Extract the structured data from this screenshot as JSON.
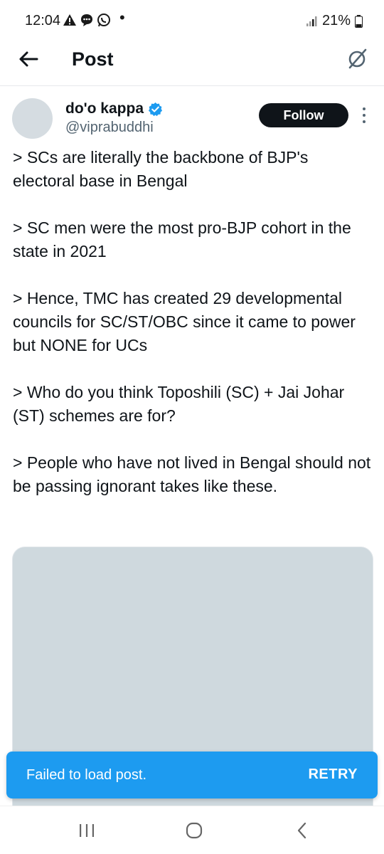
{
  "status_bar": {
    "time": "12:04",
    "battery": "21%",
    "icons": [
      "warning-icon",
      "chat-bubble-icon",
      "whatsapp-icon",
      "signal-icon",
      "battery-icon"
    ]
  },
  "header": {
    "title": "Post",
    "back_icon": "arrow-left-icon",
    "grok_icon": "grok-icon"
  },
  "post": {
    "author": {
      "name": "do'o kappa",
      "handle": "@viprabuddhi",
      "verified": true
    },
    "follow_label": "Follow",
    "paragraphs": [
      "> SCs are literally the backbone of BJP's electoral base in Bengal",
      "> SC men were the most pro-BJP cohort in the state in 2021",
      "> Hence, TMC has created 29 developmental councils for SC/ST/OBC since it came to power but NONE for UCs",
      "> Who do you think Toposhili (SC) + Jai Johar (ST) schemes are for?",
      "> People who have not lived in Bengal should not be passing ignorant takes like these."
    ]
  },
  "toast": {
    "message": "Failed to load post.",
    "action": "RETRY"
  },
  "colors": {
    "accent": "#1d9bf0",
    "text_primary": "#0f1419",
    "text_secondary": "#536471",
    "media_placeholder": "#cfd9de"
  }
}
